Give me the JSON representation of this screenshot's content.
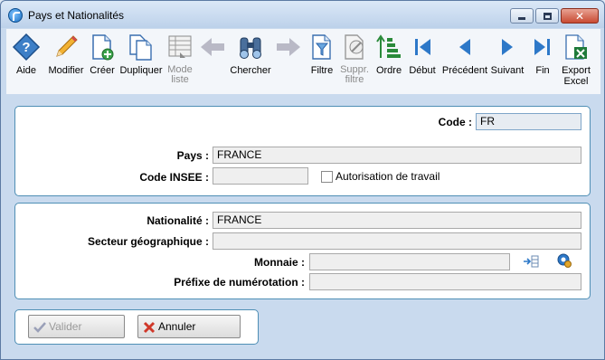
{
  "window": {
    "title": "Pays et Nationalités"
  },
  "toolbar": {
    "items": [
      {
        "label": "Aide",
        "icon": "help-icon",
        "enabled": true
      },
      {
        "label": "Modifier",
        "icon": "pencil-icon",
        "enabled": true
      },
      {
        "label": "Créer",
        "icon": "new-document-icon",
        "enabled": true
      },
      {
        "label": "Dupliquer",
        "icon": "duplicate-icon",
        "enabled": true
      },
      {
        "label": "Mode liste",
        "icon": "list-mode-icon",
        "enabled": false
      },
      {
        "label": "",
        "icon": "arrow-left-icon",
        "enabled": false
      },
      {
        "label": "Chercher",
        "icon": "binoculars-icon",
        "enabled": true
      },
      {
        "label": "",
        "icon": "arrow-right-icon",
        "enabled": false
      },
      {
        "label": "Filtre",
        "icon": "filter-icon",
        "enabled": true
      },
      {
        "label": "Suppr. filtre",
        "icon": "remove-filter-icon",
        "enabled": false
      },
      {
        "label": "Ordre",
        "icon": "sort-order-icon",
        "enabled": true
      },
      {
        "label": "Début",
        "icon": "first-record-icon",
        "enabled": true
      },
      {
        "label": "Précédent",
        "icon": "previous-icon",
        "enabled": true
      },
      {
        "label": "Suivant",
        "icon": "next-icon",
        "enabled": true
      },
      {
        "label": "Fin",
        "icon": "last-record-icon",
        "enabled": true
      },
      {
        "label": "Export Excel",
        "icon": "excel-export-icon",
        "enabled": true
      }
    ]
  },
  "form": {
    "code_label": "Code :",
    "code_value": "FR",
    "pays_label": "Pays :",
    "pays_value": "FRANCE",
    "insee_label": "Code INSEE :",
    "insee_value": "",
    "autorisation_label": "Autorisation de travail",
    "autorisation_checked": false,
    "nationalite_label": "Nationalité :",
    "nationalite_value": "FRANCE",
    "secteur_label": "Secteur géographique :",
    "secteur_value": "",
    "monnaie_label": "Monnaie :",
    "monnaie_value": "",
    "prefixe_label": "Préfixe de numérotation :",
    "prefixe_value": ""
  },
  "actions": {
    "valider_label": "Valider",
    "annuler_label": "Annuler"
  },
  "colors": {
    "accent": "#4f8fb5",
    "toolbar_blue": "#2d78c8",
    "cancel_red": "#d0382a",
    "excel_green": "#1f7a3a"
  }
}
